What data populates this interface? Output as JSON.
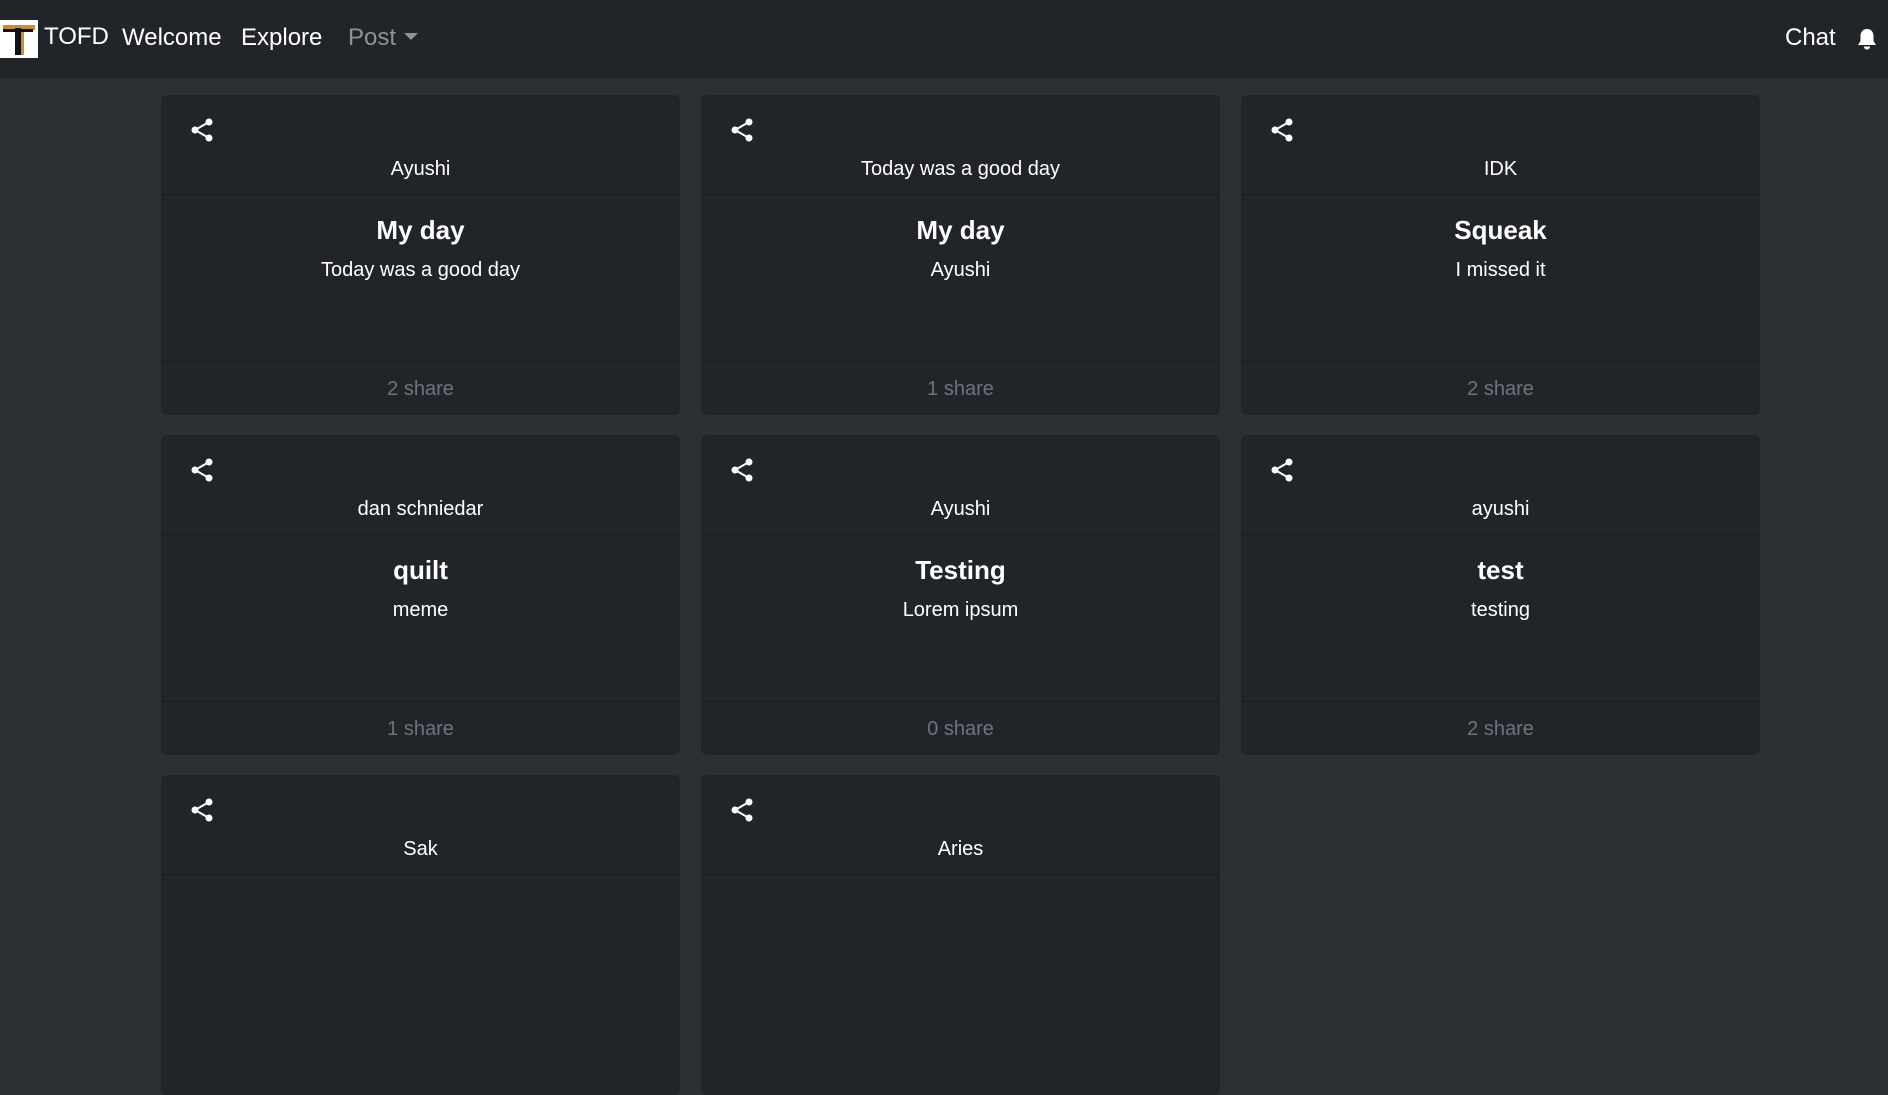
{
  "navbar": {
    "brand": "TOFD",
    "links": {
      "welcome": "Welcome",
      "explore": "Explore",
      "post": "Post",
      "chat": "Chat"
    },
    "icons": {
      "logo": "tofd-logo",
      "bell": "bell-icon",
      "post_caret": "chevron-down-icon"
    }
  },
  "colors": {
    "page_bg": "#2b3035",
    "navbar_bg": "#212529",
    "card_bg": "#212529",
    "muted_text": "#6c757d",
    "logo_accent": "#c8902a"
  },
  "cards": [
    {
      "author": "Ayushi",
      "title": "My day",
      "body": "Today was a good day",
      "shares": "2 share"
    },
    {
      "author": "Today was a good day",
      "title": "My day",
      "body": "Ayushi",
      "shares": "1 share"
    },
    {
      "author": "IDK",
      "title": "Squeak",
      "body": "I missed it",
      "shares": "2 share"
    },
    {
      "author": "dan schniedar",
      "title": "quilt",
      "body": "meme",
      "shares": "1 share"
    },
    {
      "author": "Ayushi",
      "title": "Testing",
      "body": "Lorem ipsum",
      "shares": "0 share"
    },
    {
      "author": "ayushi",
      "title": "test",
      "body": "testing",
      "shares": "2 share"
    },
    {
      "author": "Sak",
      "title": "",
      "body": "",
      "shares": ""
    },
    {
      "author": "Aries",
      "title": "",
      "body": "",
      "shares": ""
    }
  ]
}
